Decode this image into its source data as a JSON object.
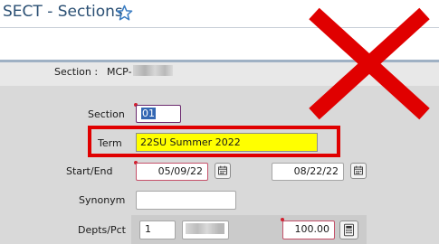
{
  "window": {
    "title": "SECT - Sections"
  },
  "header": {
    "section_label": "Section :",
    "section_value": "MCP-"
  },
  "form": {
    "section": {
      "label": "Section",
      "value": "01"
    },
    "term": {
      "label": "Term",
      "value": "22SU Summer 2022"
    },
    "start_end": {
      "label": "Start/End",
      "start": "05/09/22",
      "end": "08/22/22"
    },
    "synonym": {
      "label": "Synonym",
      "value": ""
    },
    "depts_pct": {
      "label": "Depts/Pct",
      "seq": "1",
      "pct": "100.00"
    }
  },
  "icons": [
    "star-icon",
    "calendar-icon",
    "calculator-icon",
    "red-x-icon"
  ],
  "colors": {
    "title": "#2a4f73",
    "highlight_border": "#e00000",
    "highlight_fill": "#ffff00",
    "x_mark": "#e00000"
  }
}
